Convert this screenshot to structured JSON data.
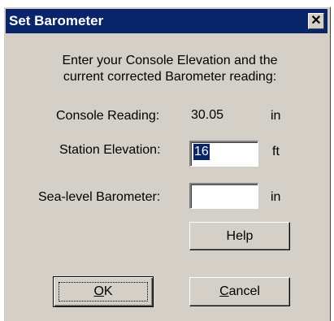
{
  "window": {
    "title": "Set Barometer",
    "close_glyph": "✕",
    "close_icon": "close-icon"
  },
  "instructions": {
    "line1": "Enter your Console Elevation and the",
    "line2": "current corrected Barometer reading:"
  },
  "console_reading": {
    "label": "Console Reading:",
    "value": "30.05",
    "unit": "in"
  },
  "station_elevation": {
    "label": "Station Elevation:",
    "value": "16",
    "unit": "ft"
  },
  "sea_level_barometer": {
    "label": "Sea-level Barometer:",
    "value": "",
    "unit": "in"
  },
  "buttons": {
    "help": "Help",
    "ok_mnemonic": "O",
    "ok_rest": "K",
    "cancel_mnemonic": "C",
    "cancel_rest": "ancel"
  },
  "colors": {
    "dialog_face": "#d4d0c8",
    "titlebar": "#0a246a",
    "selection": "#0a246a"
  }
}
